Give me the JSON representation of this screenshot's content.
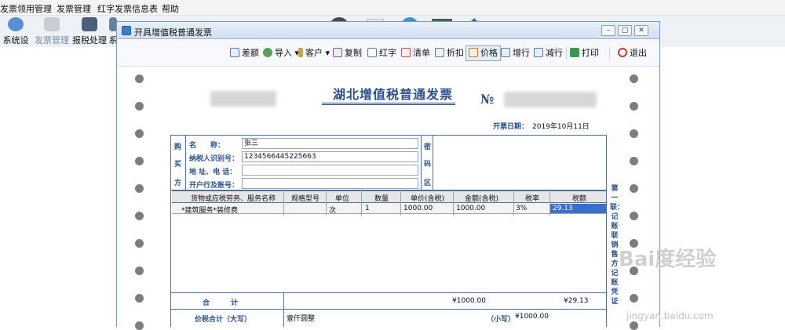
{
  "menu": [
    "发票领用管理",
    "发票管理",
    "红字发票信息表",
    "帮助"
  ],
  "app_toolbar": [
    "系统设置",
    "发票管理",
    "报税处理",
    "系"
  ],
  "dialog": {
    "title": "开具增值税普通发票",
    "toolbar": [
      "差额",
      "导入",
      "客户",
      "复制",
      "红字",
      "清单",
      "折扣",
      "价格",
      "增行",
      "减行",
      "打印",
      "退出"
    ]
  },
  "invoice": {
    "title": "湖北增值税普通发票",
    "no_label": "№",
    "date_label": "开票日期：",
    "date_value": "2019年10月11日",
    "buyer_side": [
      "购",
      "买",
      "方"
    ],
    "secret_side": [
      "密",
      "码",
      "区"
    ],
    "field_labels": [
      "名　　称：",
      "纳税人识别号：",
      "地 址、电 话：",
      "开户行及账号："
    ],
    "fields": {
      "name": "张三",
      "taxid": "1234566445225663",
      "addr_phone": "",
      "bank_account": ""
    },
    "columns": [
      "货物或应税劳务、服务名称",
      "规格型号",
      "单位",
      "数量",
      "单价(含税)",
      "金额(含税)",
      "税率",
      "税额"
    ],
    "rows": [
      {
        "name": "*建筑服务*装修费",
        "spec": "",
        "unit": "次",
        "qty": "1",
        "price": "1000.00",
        "amount": "1000.00",
        "rate": "3%",
        "tax": "29.13"
      }
    ],
    "total_label": "合　　　计",
    "total_amount": "¥1000.00",
    "total_tax": "¥29.13",
    "grand_label": "价税合计（大写）",
    "grand_upper": "壹仟圆整",
    "small_label": "（小写）",
    "grand_small": "¥1000.00",
    "side_note": "第一联：记账联 销售方记账凭证"
  },
  "watermark": {
    "brand": "Bai度经验",
    "url": "jingyan.baidu.com"
  },
  "colors": {
    "accent": "#2a4f91",
    "selection": "#3a6fcc",
    "perforation": "#7d7d7d"
  }
}
